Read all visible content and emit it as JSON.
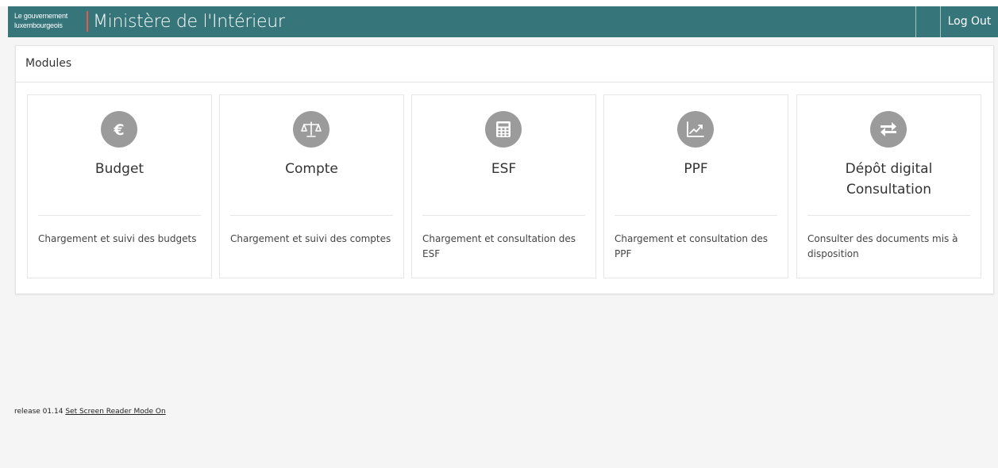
{
  "header": {
    "brand_line1": "Le gouvernement",
    "brand_line2": "luxembourgeois",
    "title": "Ministère de l'Intérieur",
    "logout_label": "Log Out",
    "bar_color": "#36767b",
    "accent_color": "#e8574a"
  },
  "panel": {
    "heading": "Modules"
  },
  "modules": [
    {
      "icon": "euro-icon",
      "title": "Budget",
      "title_line2": "",
      "description": "Chargement et suivi des budgets"
    },
    {
      "icon": "balance-scale-icon",
      "title": "Compte",
      "title_line2": "",
      "description": "Chargement et suivi des comptes"
    },
    {
      "icon": "calculator-icon",
      "title": "ESF",
      "title_line2": "",
      "description": "Chargement et consultation des ESF"
    },
    {
      "icon": "line-chart-icon",
      "title": "PPF",
      "title_line2": "",
      "description": "Chargement et consultation des PPF"
    },
    {
      "icon": "exchange-icon",
      "title": "Dépôt digital",
      "title_line2": "Consultation",
      "description": "Consulter des documents mis à disposition"
    }
  ],
  "footer": {
    "release_text": "release 01.14",
    "screen_reader_link": "Set Screen Reader Mode On"
  }
}
